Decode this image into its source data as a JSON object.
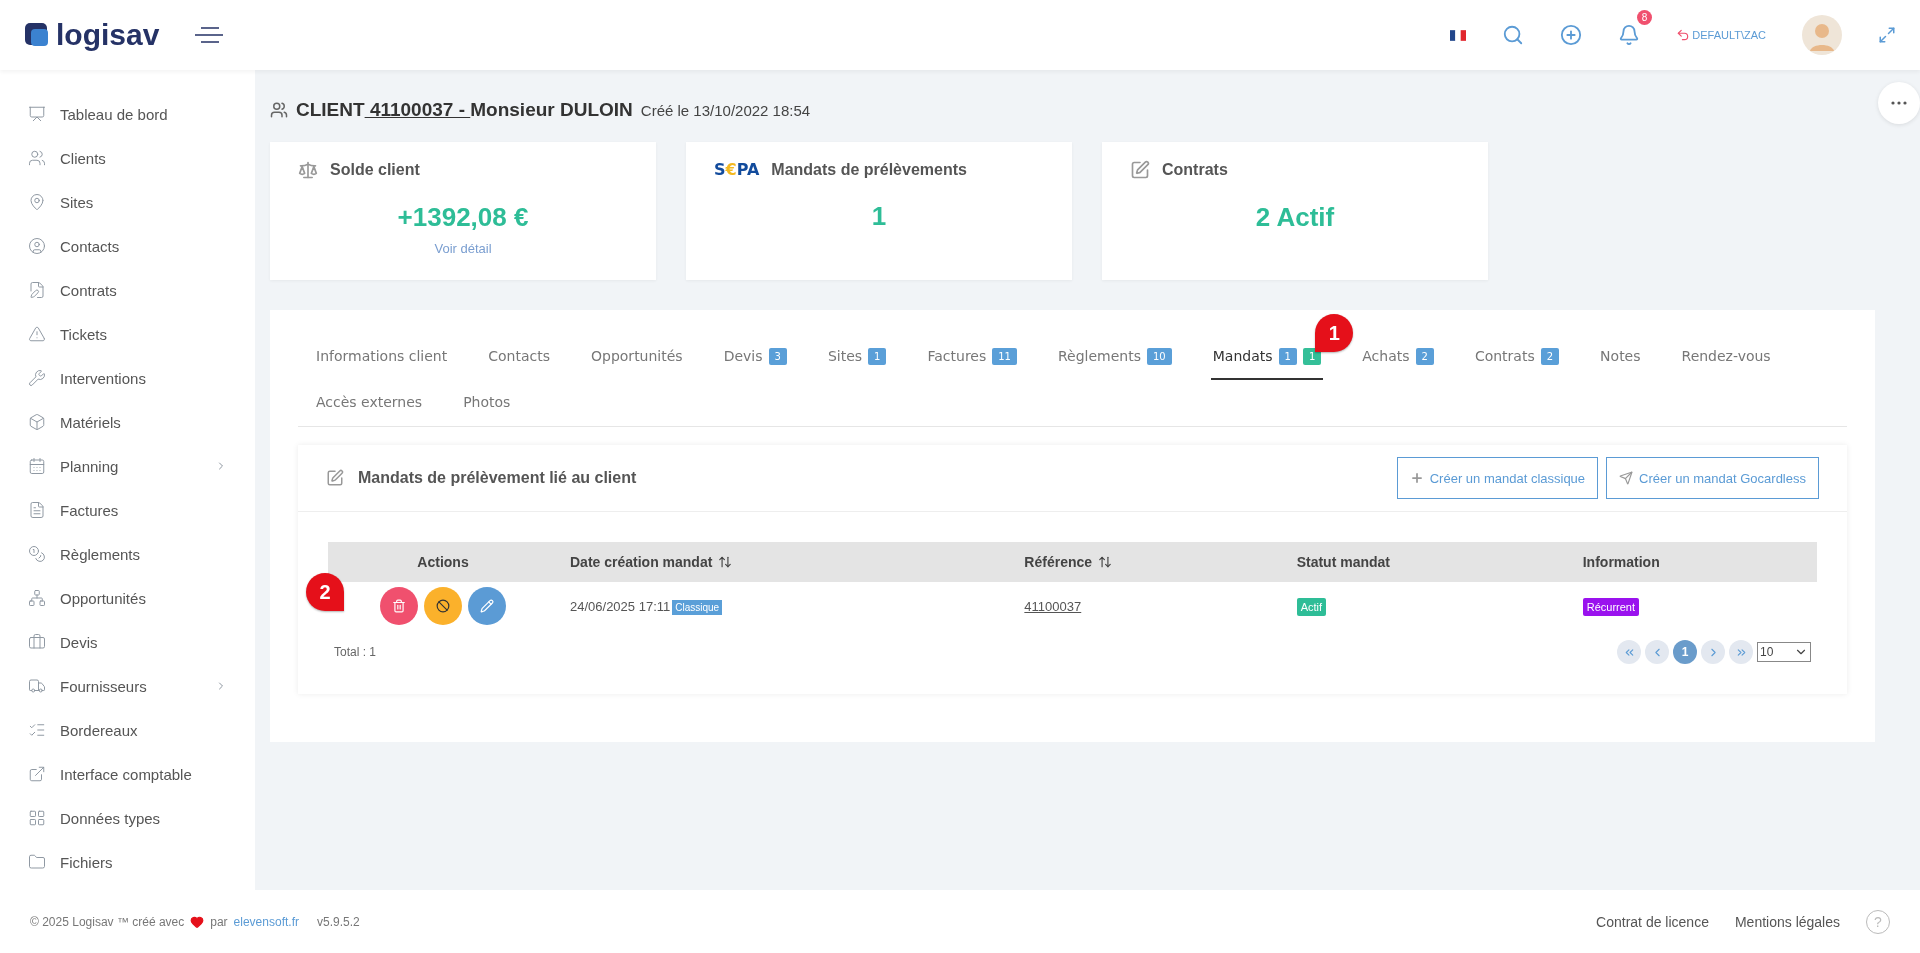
{
  "header": {
    "logo": "logisav",
    "notifications": "8",
    "user": "DEFAULT\\ZAC"
  },
  "sidebar": {
    "items": [
      {
        "label": "Tableau de bord",
        "expandable": false
      },
      {
        "label": "Clients",
        "expandable": false
      },
      {
        "label": "Sites",
        "expandable": false
      },
      {
        "label": "Contacts",
        "expandable": false
      },
      {
        "label": "Contrats",
        "expandable": false
      },
      {
        "label": "Tickets",
        "expandable": false
      },
      {
        "label": "Interventions",
        "expandable": false
      },
      {
        "label": "Matériels",
        "expandable": false
      },
      {
        "label": "Planning",
        "expandable": true
      },
      {
        "label": "Factures",
        "expandable": false
      },
      {
        "label": "Règlements",
        "expandable": false
      },
      {
        "label": "Opportunités",
        "expandable": false
      },
      {
        "label": "Devis",
        "expandable": false
      },
      {
        "label": "Fournisseurs",
        "expandable": true
      },
      {
        "label": "Bordereaux",
        "expandable": false
      },
      {
        "label": "Interface comptable",
        "expandable": false
      },
      {
        "label": "Données types",
        "expandable": false
      },
      {
        "label": "Fichiers",
        "expandable": false
      }
    ]
  },
  "page_title": {
    "label": "CLIENT",
    "code": " 41100037 - ",
    "name": "Monsieur DULOIN",
    "created": "Créé le 13/10/2022 18:54"
  },
  "cards": [
    {
      "kind": "balance",
      "title": "Solde client",
      "value": "+1392,08 €",
      "link": "Voir détail"
    },
    {
      "kind": "sepa",
      "logo": [
        "S",
        "€",
        "PA"
      ],
      "title": "Mandats de prélèvements",
      "value": "1"
    },
    {
      "kind": "contracts",
      "title": "Contrats",
      "value": "2 Actif"
    }
  ],
  "tabs": [
    {
      "label": "Informations client",
      "selected": false
    },
    {
      "label": "Contacts",
      "selected": false
    },
    {
      "label": "Opportunités",
      "selected": false
    },
    {
      "label": "Devis",
      "selected": false,
      "badges": [
        {
          "text": "3",
          "color": "#5a9fd8"
        }
      ]
    },
    {
      "label": "Sites",
      "selected": false,
      "badges": [
        {
          "text": "1",
          "color": "#5a9fd8"
        }
      ]
    },
    {
      "label": "Factures",
      "selected": false,
      "badges": [
        {
          "text": "11",
          "color": "#5a9fd8"
        }
      ]
    },
    {
      "label": "Règlements",
      "selected": false,
      "badges": [
        {
          "text": "10",
          "color": "#5a9fd8"
        }
      ]
    },
    {
      "label": "Mandats",
      "selected": true,
      "badges": [
        {
          "text": "1",
          "color": "#5a9fd8"
        },
        {
          "text": "1",
          "color": "#34bf98"
        }
      ]
    },
    {
      "label": "Achats",
      "selected": false,
      "badges": [
        {
          "text": "2",
          "color": "#5a9fd8"
        }
      ]
    },
    {
      "label": "Contrats",
      "selected": false,
      "badges": [
        {
          "text": "2",
          "color": "#5a9fd8"
        }
      ]
    },
    {
      "label": "Notes",
      "selected": false
    },
    {
      "label": "Rendez-vous",
      "selected": false
    },
    {
      "label": "Accès externes",
      "selected": false
    },
    {
      "label": "Photos",
      "selected": false
    }
  ],
  "callouts": [
    "1",
    "2"
  ],
  "mandates_panel": {
    "title": "Mandats de prélèvement lié au client",
    "buttons": [
      "Créer un mandat classique",
      "Créer un mandat Gocardless"
    ],
    "table": {
      "columns": [
        {
          "label": "Actions",
          "sortable": false
        },
        {
          "label": "Date création mandat",
          "sortable": true
        },
        {
          "label": "Référence",
          "sortable": true
        },
        {
          "label": "Statut mandat",
          "sortable": false
        },
        {
          "label": "Information",
          "sortable": false
        }
      ],
      "rows": [
        {
          "date": "24/06/2025 17:11",
          "type": "Classique",
          "reference": "41100037",
          "status": {
            "text": "Actif",
            "color": "#2ebd97"
          },
          "information": {
            "text": "Récurrent",
            "color": "#9a12ee"
          }
        }
      ]
    },
    "total": "Total : 1",
    "page": "1",
    "per_page": "10"
  },
  "footer": {
    "copyright": "© 2025 Logisav ™ créé avec",
    "by": "par",
    "site": "elevensoft.fr",
    "version": "v5.9.5.2",
    "links": [
      "Contrat de licence",
      "Mentions légales"
    ],
    "help": "?"
  }
}
